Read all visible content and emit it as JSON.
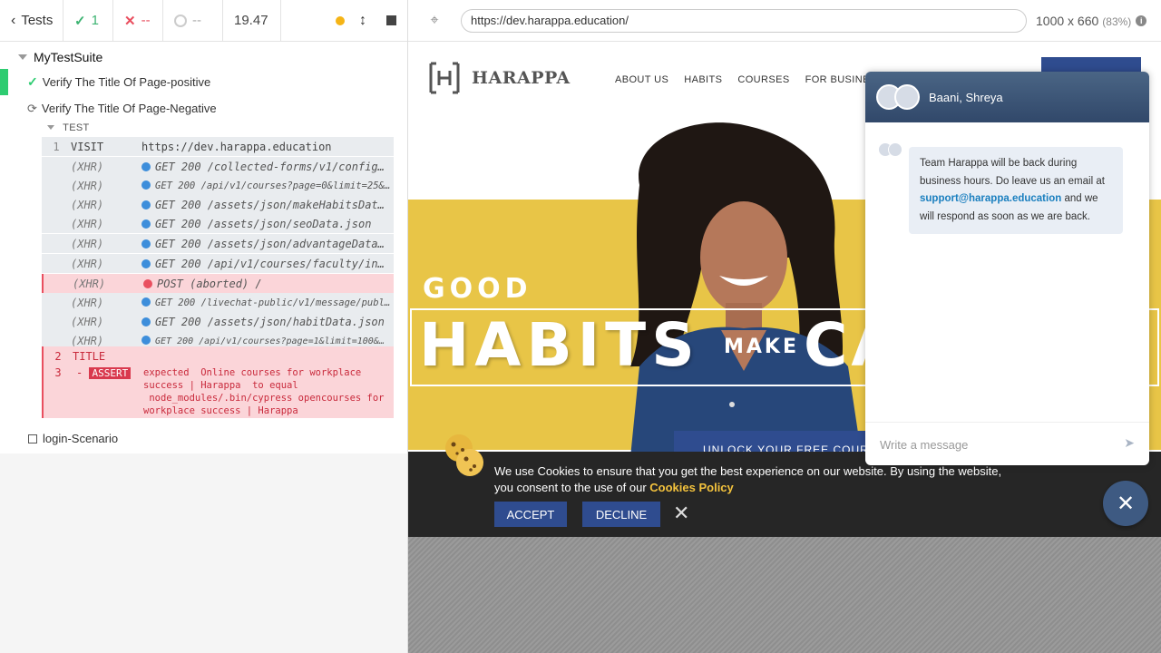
{
  "runner": {
    "tests_label": "Tests",
    "passed_count": "1",
    "failed_count": "--",
    "pending_count": "--",
    "duration": "19.47"
  },
  "suite": {
    "title": "MyTestSuite",
    "tests": [
      {
        "title": "Verify The Title Of Page-positive",
        "state": "passed"
      },
      {
        "title": "Verify The Title Of Page-Negative",
        "state": "running"
      },
      {
        "title": "login-Scenario",
        "state": "pending"
      }
    ],
    "section_label": "TEST",
    "commands": [
      {
        "num": "1",
        "name": "VISIT",
        "msg": "https://dev.harappa.education"
      },
      {
        "name": "(XHR)",
        "msg": "GET 200 /collected-forms/v1/config…"
      },
      {
        "name": "(XHR)",
        "msg": "GET 200 /api/v1/courses?page=0&limit=25&p…"
      },
      {
        "name": "(XHR)",
        "msg": "GET 200 /assets/json/makeHabitsDat…"
      },
      {
        "name": "(XHR)",
        "msg": "GET 200 /assets/json/seoData.json"
      },
      {
        "name": "(XHR)",
        "msg": "GET 200 /assets/json/advantageData…"
      },
      {
        "name": "(XHR)",
        "msg": "GET 200 /api/v1/courses/faculty/in…"
      },
      {
        "name": "(XHR)",
        "msg": "POST (aborted) /"
      },
      {
        "name": "(XHR)",
        "msg": "GET 200 /livechat-public/v1/message/publi…"
      },
      {
        "name": "(XHR)",
        "msg": "GET 200 /assets/json/habitData.json"
      },
      {
        "name": "(XHR)",
        "msg": "GET 200 /api/v1/courses?page=1&limit=100&…"
      }
    ],
    "title_cmd": {
      "num": "2",
      "name": "TITLE"
    },
    "assert_cmd": {
      "num": "3",
      "prefix": "-",
      "badge": "ASSERT",
      "line1": "expected  Online courses for workplace",
      "line2": "success | Harappa  to equal",
      "line3": " node_modules/.bin/cypress opencourses for",
      "line4": "workplace success | Harappa"
    }
  },
  "aut": {
    "url": "https://dev.harappa.education/",
    "viewport": "1000 x 660",
    "scale": "(83%)"
  },
  "site": {
    "name": "HARAPPA",
    "nav": [
      "ABOUT US",
      "HABITS",
      "COURSES",
      "FOR BUSINES"
    ],
    "hero_good": "GOOD",
    "hero_habits": "HABITS",
    "hero_make": "MAKE",
    "hero_ca": "CA",
    "unlock_label": "UNLOCK YOUR FREE COURSE"
  },
  "cookie": {
    "text": "We use Cookies to ensure that you get the best experience on our website. By using the website, you consent to the use of our ",
    "policy_link": "Cookies Policy",
    "accept_label": "ACCEPT",
    "decline_label": "DECLINE"
  },
  "chat": {
    "agents": "Baani, Shreya",
    "message_pre": "Team Harappa will be back during business hours. Do leave us an email at ",
    "email": "support@harappa.education",
    "message_post": " and we will respond as soon as we are back.",
    "input_placeholder": "Write a message"
  },
  "colors": {
    "pass": "#2ecc71",
    "fail": "#e94f5f",
    "harappa_blue": "#2f4c8f",
    "hero_yellow": "#e8c547"
  }
}
